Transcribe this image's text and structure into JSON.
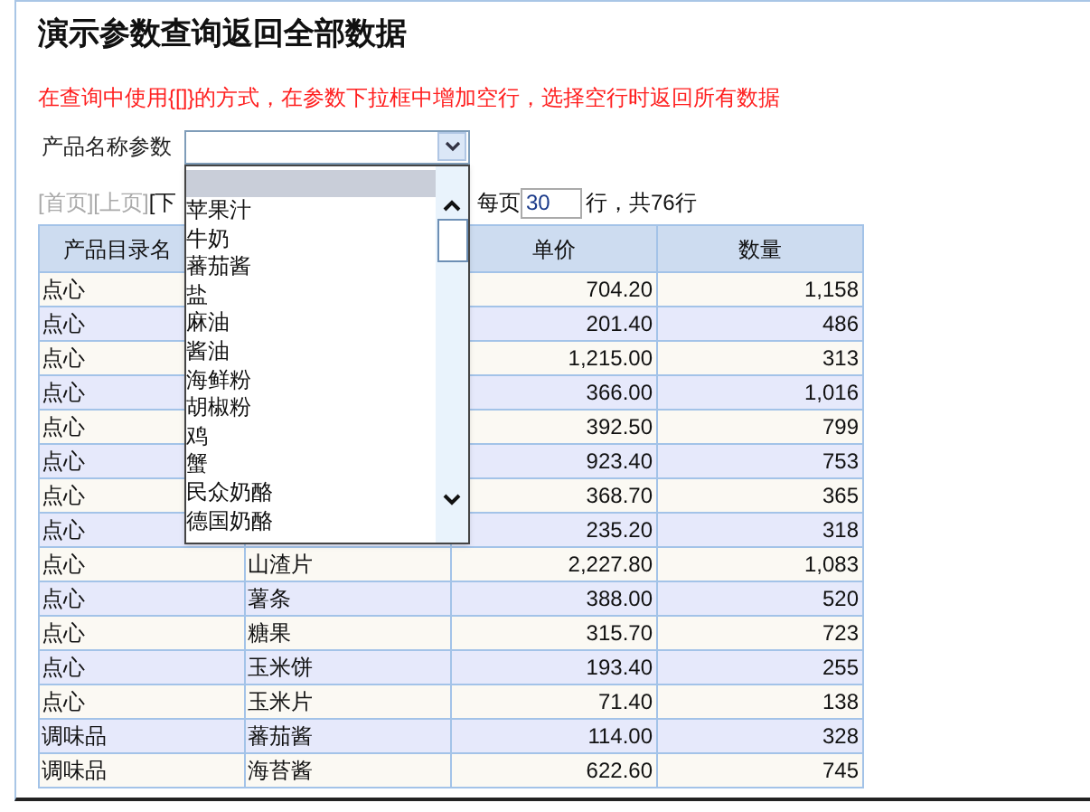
{
  "title": "演示参数查询返回全部数据",
  "note": "在查询中使用{[]}的方式，在参数下拉框中增加空行，选择空行时返回所有数据",
  "param": {
    "label": "产品名称参数",
    "expanded": true,
    "options": [
      {
        "selected": true
      },
      {
        "label": "苹果汁",
        "selected": false
      },
      {
        "label": "牛奶",
        "selected": false
      },
      {
        "label": "蕃茄酱",
        "selected": false
      },
      {
        "label": "盐",
        "selected": false
      },
      {
        "label": "麻油",
        "selected": false
      },
      {
        "label": "酱油",
        "selected": false
      },
      {
        "label": "海鲜粉",
        "selected": false
      },
      {
        "label": "胡椒粉",
        "selected": false
      },
      {
        "label": "鸡",
        "selected": false
      },
      {
        "label": "蟹",
        "selected": false
      },
      {
        "label": "民众奶酪",
        "selected": false
      },
      {
        "label": "德国奶酪",
        "selected": false
      }
    ]
  },
  "pager": {
    "links": [
      {
        "label": "[首页]",
        "disabled": true
      },
      {
        "label": "[上页]",
        "disabled": true
      },
      {
        "label": "[下",
        "disabled": false
      }
    ],
    "per_page_label": "每页",
    "per_page": "30",
    "total": "行，共76行"
  },
  "table": {
    "columns": [
      "产品目录名",
      "单价",
      "数量"
    ],
    "rows": [
      {
        "category": "点心",
        "price": "704.20",
        "qty": "1,158"
      },
      {
        "category": "点心",
        "price": "201.40",
        "qty": "486"
      },
      {
        "category": "点心",
        "price": "1,215.00",
        "qty": "313"
      },
      {
        "category": "点心",
        "price": "366.00",
        "qty": "1,016"
      },
      {
        "category": "点心",
        "price": "392.50",
        "qty": "799"
      },
      {
        "category": "点心",
        "price": "923.40",
        "qty": "753"
      },
      {
        "category": "点心",
        "price": "368.70",
        "qty": "365"
      },
      {
        "category": "点心",
        "price": "235.20",
        "qty": "318"
      },
      {
        "category": "点心",
        "name": "山渣片",
        "price": "2,227.80",
        "qty": "1,083"
      },
      {
        "category": "点心",
        "name": "薯条",
        "price": "388.00",
        "qty": "520"
      },
      {
        "category": "点心",
        "name": "糖果",
        "price": "315.70",
        "qty": "723"
      },
      {
        "category": "点心",
        "name": "玉米饼",
        "price": "193.40",
        "qty": "255"
      },
      {
        "category": "点心",
        "name": "玉米片",
        "price": "71.40",
        "qty": "138"
      },
      {
        "category": "调味品",
        "name": "蕃茄酱",
        "price": "114.00",
        "qty": "328"
      },
      {
        "category": "调味品",
        "name": "海苔酱",
        "price": "622.60",
        "qty": "745"
      }
    ]
  }
}
